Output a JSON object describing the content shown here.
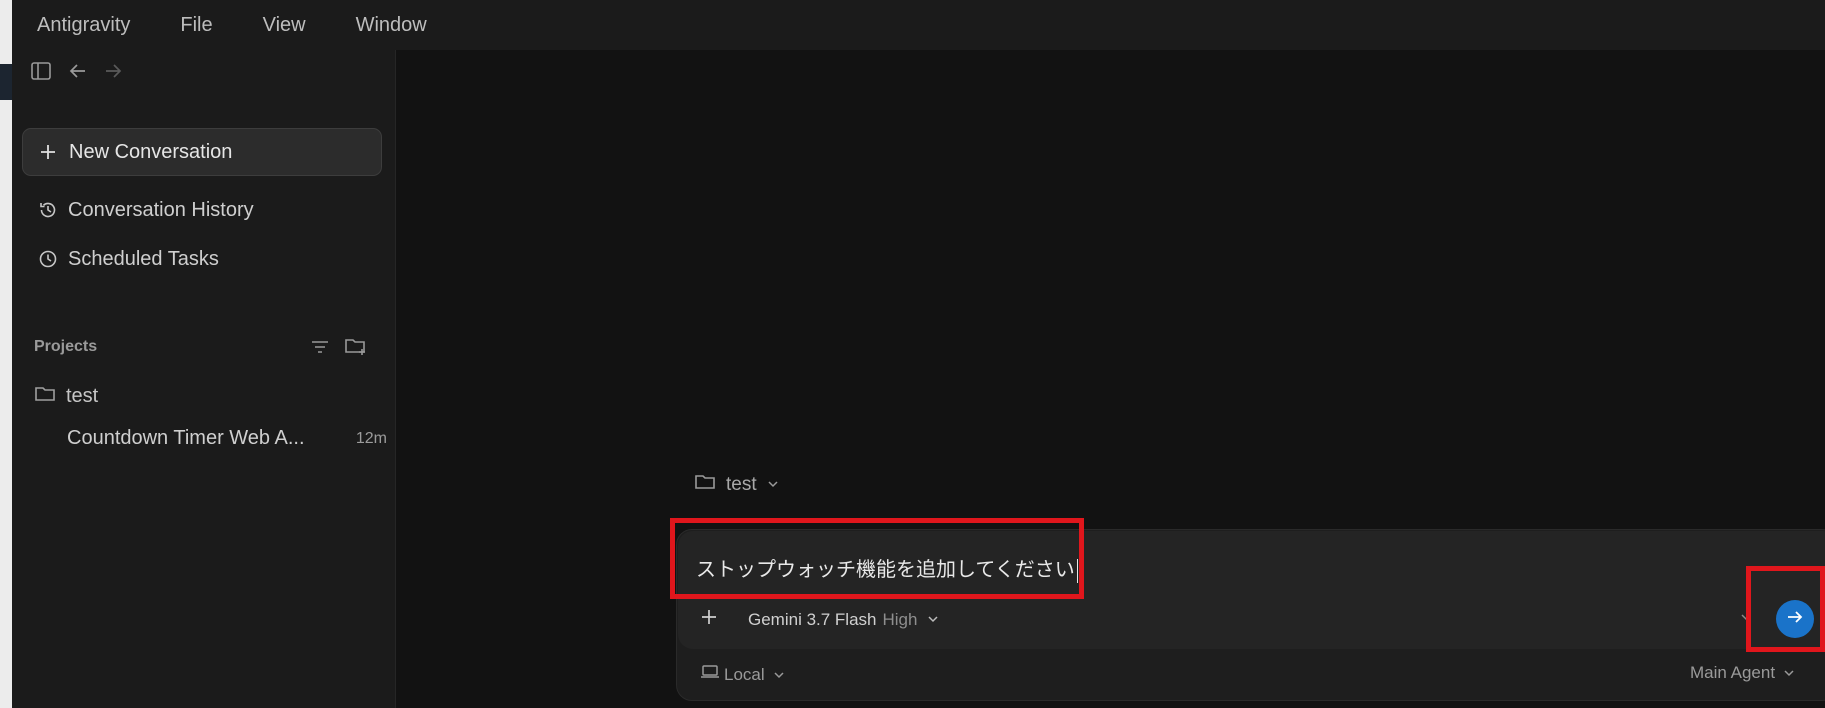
{
  "menubar": {
    "items": [
      "Antigravity",
      "File",
      "View",
      "Window"
    ]
  },
  "sidebar": {
    "new_conversation": "New Conversation",
    "conversation_history": "Conversation History",
    "scheduled_tasks": "Scheduled Tasks",
    "projects_heading": "Projects",
    "project_name": "test",
    "conversation_title": "Countdown Timer Web A...",
    "conversation_age": "12m"
  },
  "composer": {
    "context_folder": "test",
    "prompt_text": "ストップウォッチ機能を追加してください",
    "model_name": "Gemini 3.7 Flash",
    "model_level": "High",
    "location": "Local",
    "agent_mode": "Main Agent"
  },
  "colors": {
    "accent": "#1a73c9",
    "highlight": "#e0161c",
    "background": "#131313",
    "sidebar": "#1b1b1b"
  },
  "icons": [
    "sidebar-toggle-icon",
    "back-arrow-icon",
    "forward-arrow-icon",
    "plus-icon",
    "history-icon",
    "clock-icon",
    "filter-icon",
    "new-folder-icon",
    "folder-icon",
    "chevron-down-icon",
    "send-arrow-icon",
    "laptop-icon"
  ]
}
